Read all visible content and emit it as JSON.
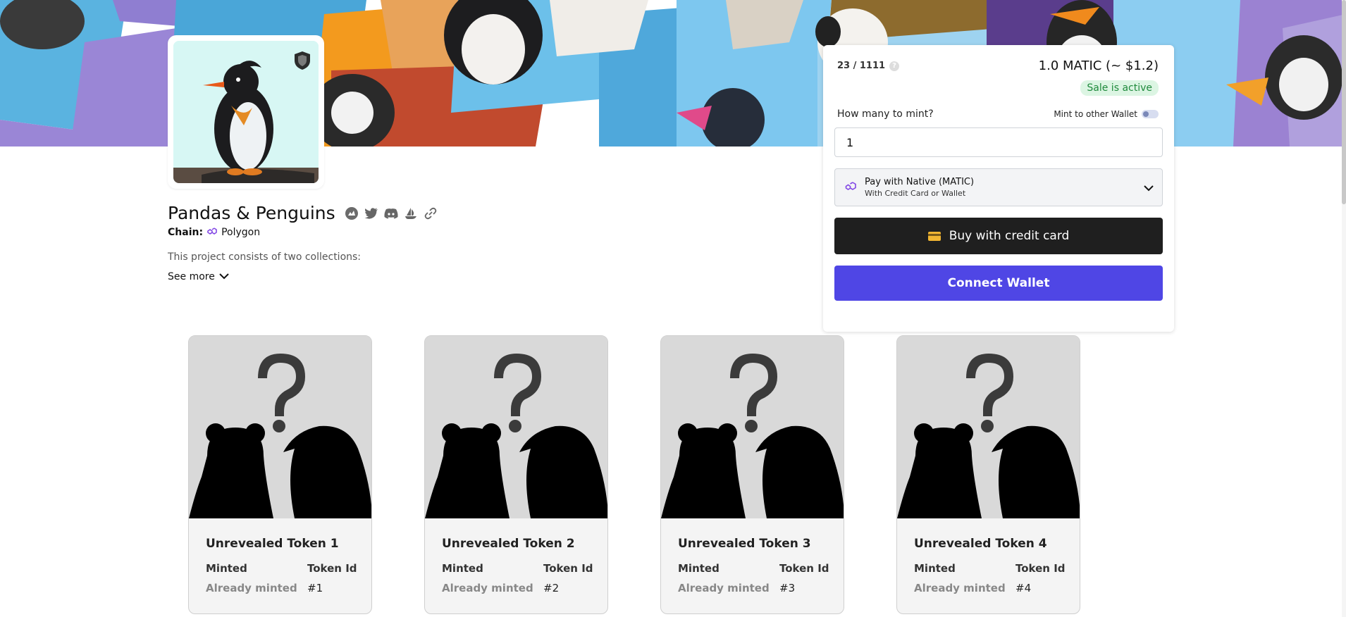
{
  "project": {
    "title": "Pandas & Penguins",
    "chain_label": "Chain:",
    "chain_value": "Polygon",
    "description": "This project consists of two collections:",
    "see_more": "See more"
  },
  "social_icons": [
    "opensea-stats-icon",
    "twitter-icon",
    "discord-icon",
    "opensea-icon",
    "link-icon"
  ],
  "mint": {
    "supply": "23 / 1111",
    "price": "1.0 MATIC (~ $1.2)",
    "sale_status": "Sale is active",
    "quantity_label": "How many to mint?",
    "quantity_value": "1",
    "other_wallet_label": "Mint to other Wallet",
    "pay_main": "Pay with Native (MATIC)",
    "pay_sub": "With Credit Card or Wallet",
    "buy_credit_label": "Buy with credit card",
    "connect_label": "Connect Wallet"
  },
  "cards": [
    {
      "title": "Unrevealed Token 1",
      "k1": "Minted",
      "k2": "Token Id",
      "v1": "Already minted",
      "v2": "#1"
    },
    {
      "title": "Unrevealed Token 2",
      "k1": "Minted",
      "k2": "Token Id",
      "v1": "Already minted",
      "v2": "#2"
    },
    {
      "title": "Unrevealed Token 3",
      "k1": "Minted",
      "k2": "Token Id",
      "v1": "Already minted",
      "v2": "#3"
    },
    {
      "title": "Unrevealed Token 4",
      "k1": "Minted",
      "k2": "Token Id",
      "v1": "Already minted",
      "v2": "#4"
    }
  ],
  "colors": {
    "connect_button": "#4f46e5",
    "credit_button": "#1f1f1f",
    "sale_badge_bg": "#dcf5e3",
    "sale_badge_text": "#1f8a3c",
    "polygon": "#8247e5"
  }
}
